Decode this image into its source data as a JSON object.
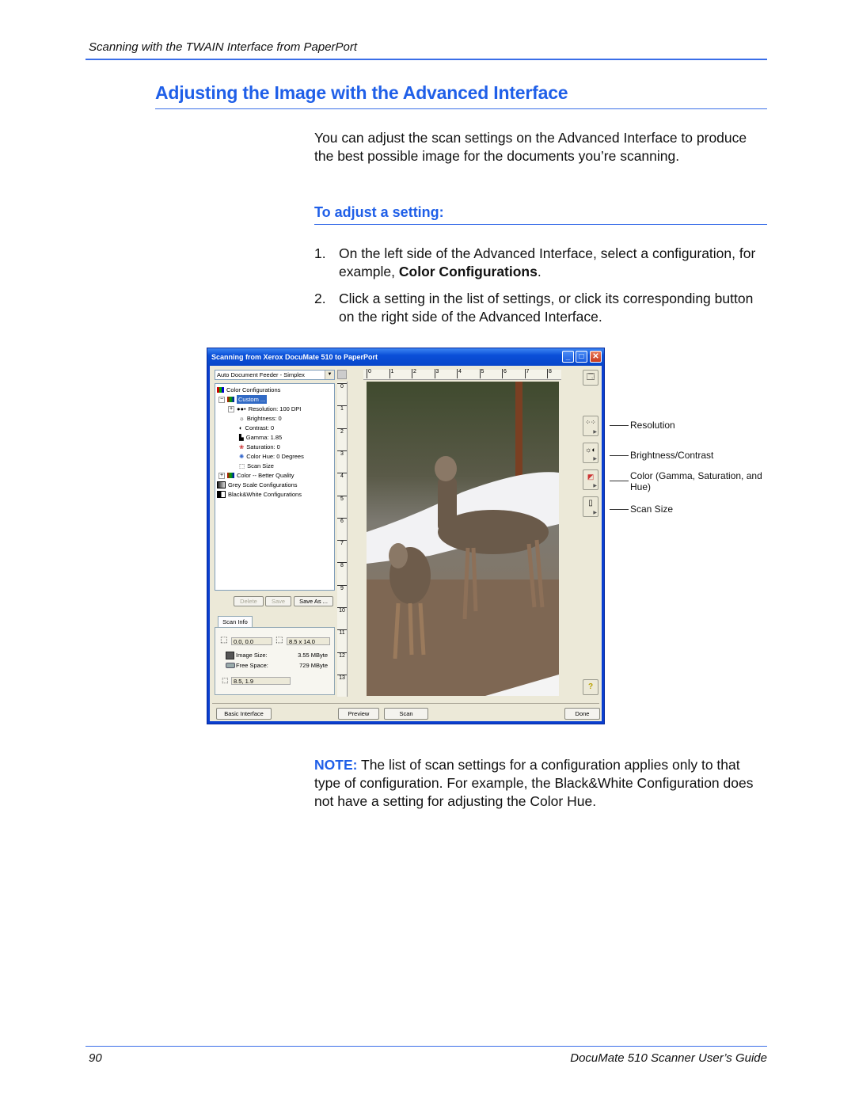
{
  "header": {
    "running_head": "Scanning with the TWAIN Interface from PaperPort"
  },
  "section": {
    "title": "Adjusting the Image with the Advanced Interface",
    "intro": "You can adjust the scan settings on the Advanced Interface to produce the best possible image for the documents you’re scanning.",
    "subtitle": "To adjust a setting:",
    "steps": [
      {
        "num": "1.",
        "text_before": "On the left side of the Advanced Interface, select a configuration, for example, ",
        "bold": "Color Configurations",
        "text_after": "."
      },
      {
        "num": "2.",
        "text_before": "Click a setting in the list of settings, or click its corresponding button on the right side of the Advanced Interface.",
        "bold": "",
        "text_after": ""
      }
    ],
    "note_label": "NOTE:",
    "note_text": " The list of scan settings for a configuration applies only to that type of configuration. For example, the Black&White Configuration does not have a setting for adjusting the Color Hue."
  },
  "dialog": {
    "title": "Scanning from Xerox DocuMate 510 to PaperPort",
    "window_buttons": {
      "minimize": "_",
      "maximize": "□",
      "close": "✕"
    },
    "source_select": "Auto Document Feeder - Simplex",
    "tree": [
      {
        "label": "Color Configurations",
        "level": 0
      },
      {
        "label": "Custom ...",
        "level": 1,
        "selected": true
      },
      {
        "label": "Resolution: 100 DPI",
        "level": 2
      },
      {
        "label": "Brightness: 0",
        "level": 2
      },
      {
        "label": "Contrast: 0",
        "level": 2
      },
      {
        "label": "Gamma: 1.85",
        "level": 2
      },
      {
        "label": "Saturation: 0",
        "level": 2
      },
      {
        "label": "Color Hue: 0 Degrees",
        "level": 2
      },
      {
        "label": "Scan Size",
        "level": 2
      },
      {
        "label": "Color -- Better Quality",
        "level": 1
      },
      {
        "label": "Grey Scale Configurations",
        "level": 0
      },
      {
        "label": "Black&White Configurations",
        "level": 0
      }
    ],
    "config_buttons": {
      "delete": "Delete",
      "save": "Save",
      "save_as": "Save As ..."
    },
    "scan_info": {
      "tab": "Scan Info",
      "origin": "0.0, 0.0",
      "size": "8.5 x 14.0",
      "image_size_label": "Image Size:",
      "image_size_value": "3.55 MByte",
      "free_space_label": "Free Space:",
      "free_space_value": "729 MByte",
      "cursor_pos": "8.5, 1.9"
    },
    "ruler_h": [
      "0",
      "1",
      "2",
      "3",
      "4",
      "5",
      "6",
      "7",
      "8"
    ],
    "ruler_v": [
      "0",
      "1",
      "2",
      "3",
      "4",
      "5",
      "6",
      "7",
      "8",
      "9",
      "10",
      "11",
      "12",
      "13"
    ],
    "bottom_buttons": {
      "basic": "Basic Interface",
      "preview": "Preview",
      "scan": "Scan",
      "done": "Done"
    }
  },
  "callouts": [
    {
      "label": "Resolution"
    },
    {
      "label": "Brightness/Contrast"
    },
    {
      "label": "Color (Gamma, Saturation, and Hue)"
    },
    {
      "label": "Scan Size"
    }
  ],
  "footer": {
    "page_number": "90",
    "guide_title": "DocuMate 510 Scanner User’s Guide"
  },
  "colors": {
    "accent": "#1f5fe8",
    "rule": "#3a6ee8",
    "xp_title": "#0a4fd8",
    "xp_face": "#ece9d8",
    "selection": "#316ac5"
  }
}
